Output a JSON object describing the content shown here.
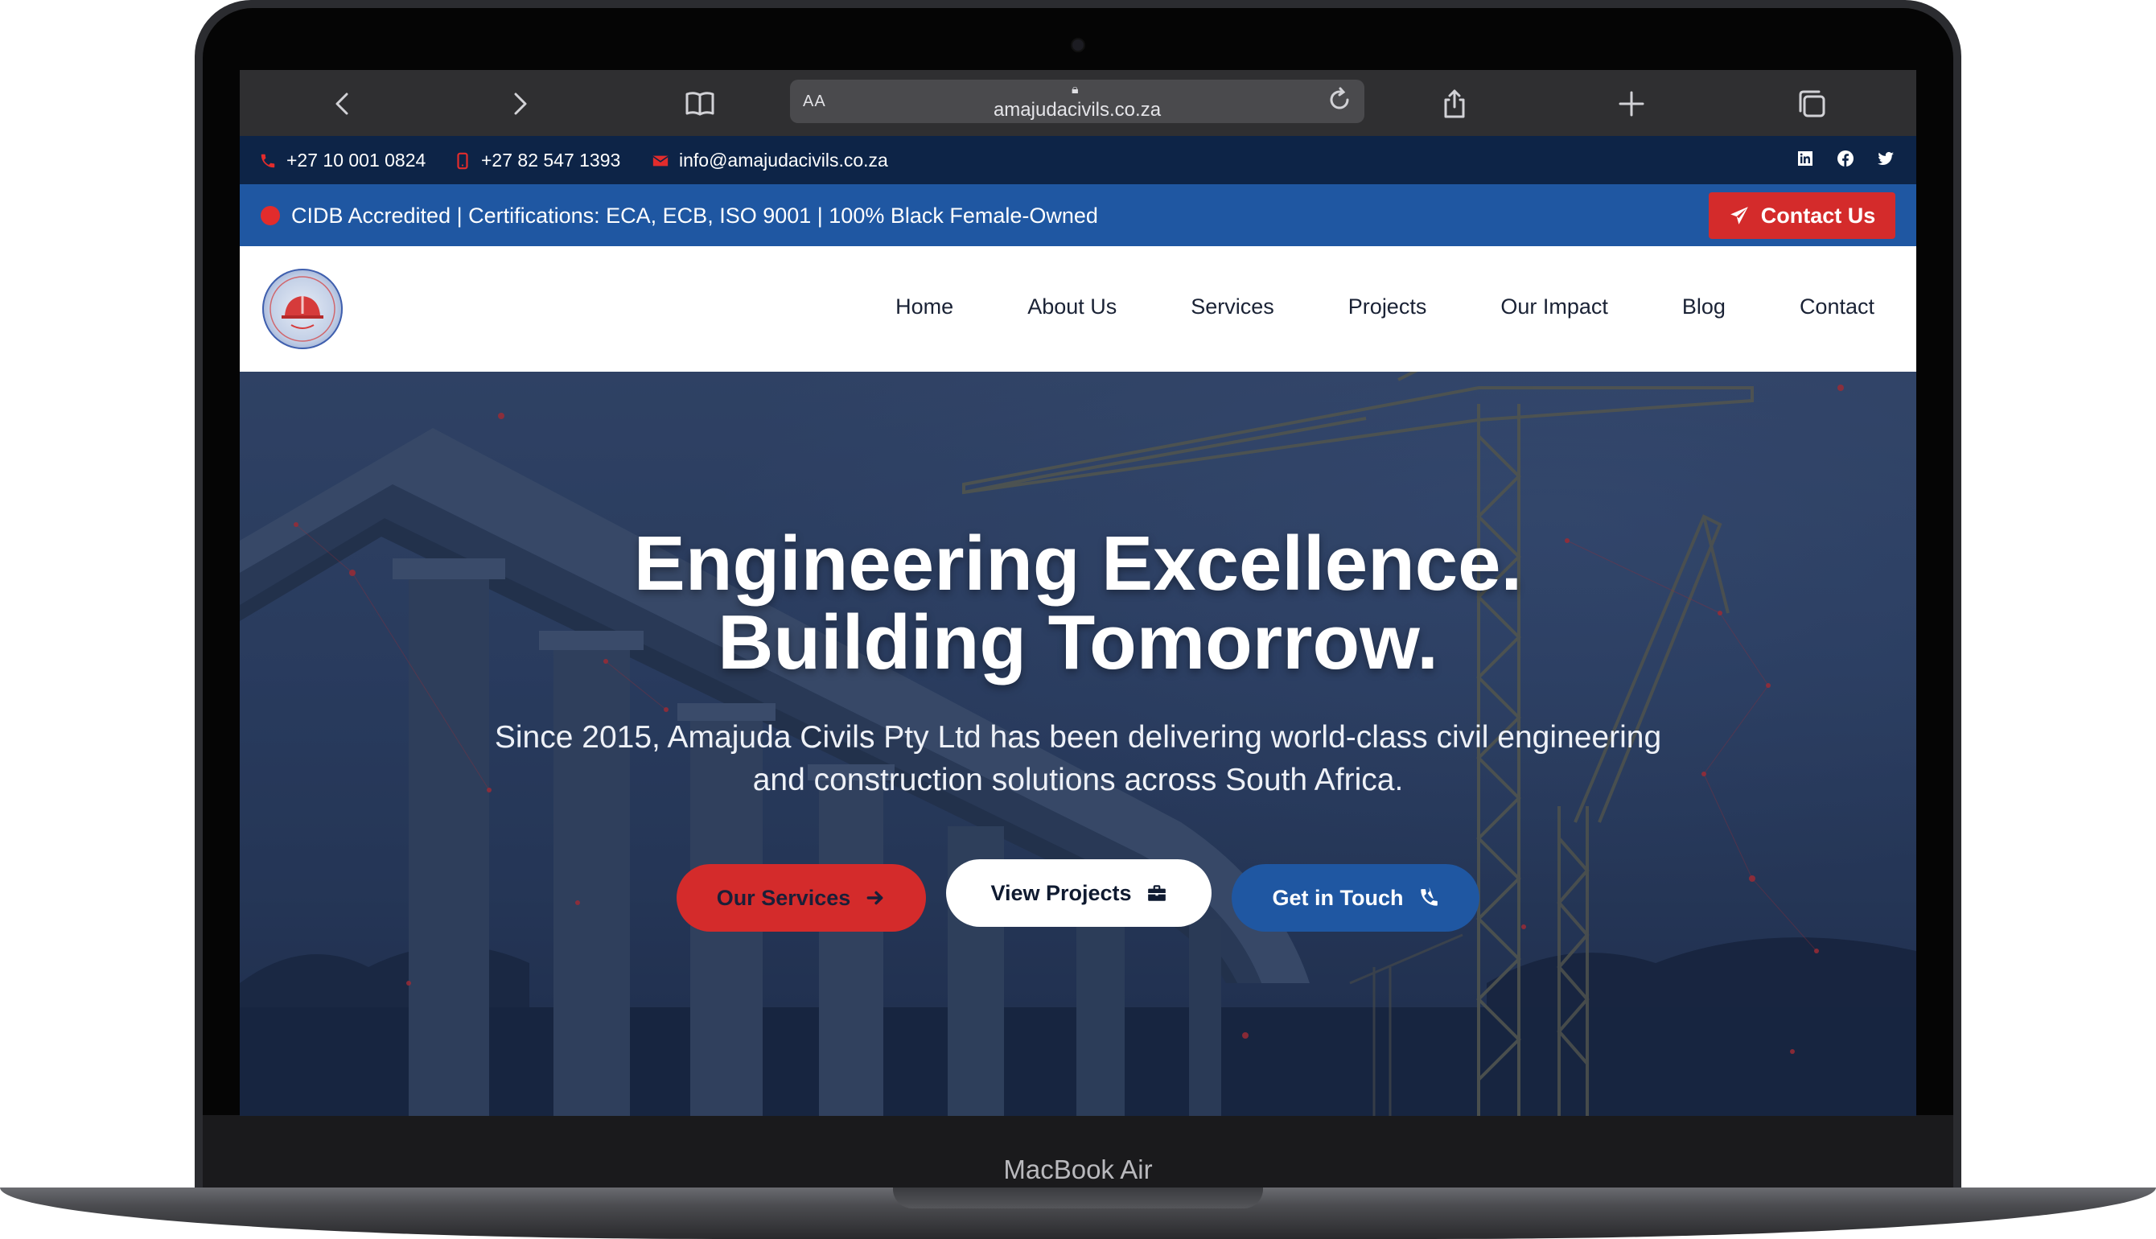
{
  "device": {
    "label": "MacBook Air"
  },
  "browser": {
    "reader_label": "AA",
    "url": "amajudacivils.co.za"
  },
  "topbar": {
    "phone_1": "+27 10 001 0824",
    "phone_2": "+27 82 547 1393",
    "email": "info@amajudacivils.co.za",
    "socials": [
      "linkedin-icon",
      "facebook-icon",
      "twitter-icon"
    ]
  },
  "accreditation": {
    "text": "CIDB Accredited | Certifications: ECA, ECB, ISO 9001 | 100% Black Female-Owned",
    "contact_label": "Contact Us"
  },
  "nav": {
    "items": [
      "Home",
      "About Us",
      "Services",
      "Projects",
      "Our Impact",
      "Blog",
      "Contact"
    ]
  },
  "hero": {
    "title_line1": "Engineering Excellence.",
    "title_line2": "Building Tomorrow.",
    "subtitle": "Since 2015, Amajuda Civils Pty Ltd has been delivering world-class civil engineering and construction solutions across South Africa.",
    "buttons": {
      "services": "Our Services",
      "projects": "View Projects",
      "touch": "Get in Touch"
    }
  },
  "colors": {
    "navy": "#0d2447",
    "blue": "#1f57a2",
    "red": "#d42b2b"
  }
}
